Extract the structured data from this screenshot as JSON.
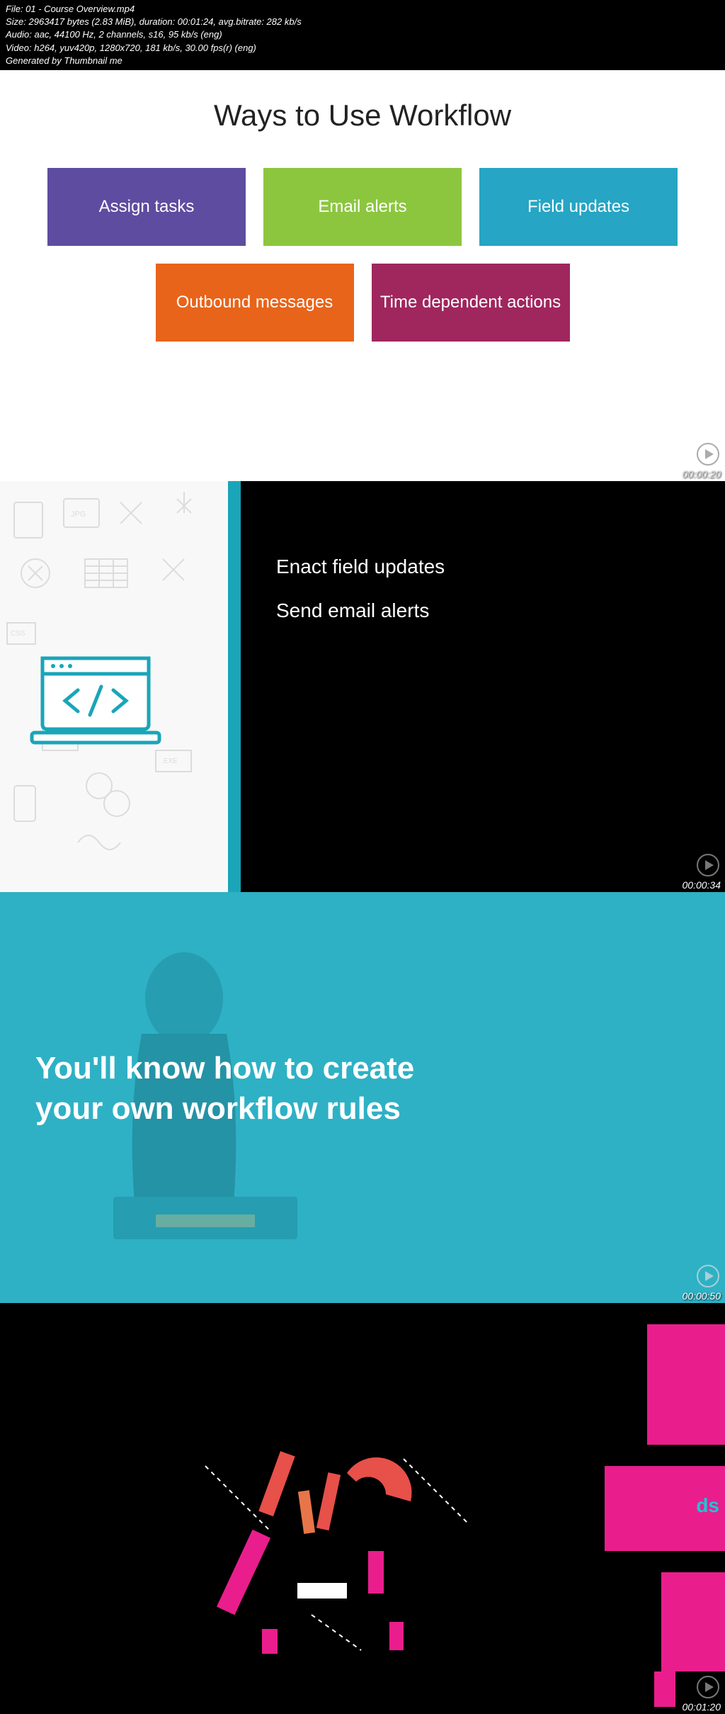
{
  "header": {
    "file": "File: 01 - Course Overview.mp4",
    "size": "Size: 2963417 bytes (2.83 MiB), duration: 00:01:24, avg.bitrate: 282 kb/s",
    "audio": "Audio: aac, 44100 Hz, 2 channels, s16, 95 kb/s (eng)",
    "video": "Video: h264, yuv420p, 1280x720, 181 kb/s, 30.00 fps(r) (eng)",
    "generated": "Generated by Thumbnail me"
  },
  "frame1": {
    "title": "Ways to Use Workflow",
    "boxes": {
      "assign": "Assign tasks",
      "email": "Email alerts",
      "field": "Field updates",
      "outbound": "Outbound messages",
      "time": "Time dependent actions"
    },
    "timestamp": "00:00:20"
  },
  "frame2": {
    "line1": "Enact field updates",
    "line2": "Send email alerts",
    "timestamp": "00:00:34"
  },
  "frame3": {
    "line1": "You'll know how to create",
    "line2": "your own workflow rules",
    "timestamp": "00:00:50"
  },
  "frame4": {
    "ds": "ds",
    "timestamp": "00:01:20"
  }
}
